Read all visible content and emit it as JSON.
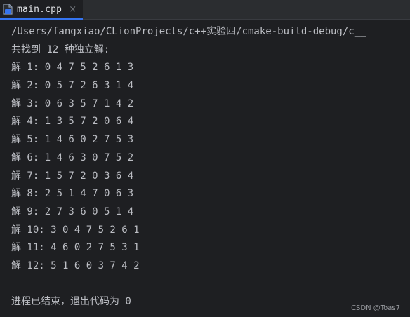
{
  "tab": {
    "filename": "main.cpp",
    "close_glyph": "×",
    "icon": "cpp-file-icon",
    "accent_color": "#3574f0"
  },
  "console": {
    "command_path": "/Users/fangxiao/CLionProjects/c++实验四/cmake-build-debug/c__",
    "summary": "共找到 12 种独立解:",
    "solutions": [
      "解 1: 0 4 7 5 2 6 1 3",
      "解 2: 0 5 7 2 6 3 1 4",
      "解 3: 0 6 3 5 7 1 4 2",
      "解 4: 1 3 5 7 2 0 6 4",
      "解 5: 1 4 6 0 2 7 5 3",
      "解 6: 1 4 6 3 0 7 5 2",
      "解 7: 1 5 7 2 0 3 6 4",
      "解 8: 2 5 1 4 7 0 6 3",
      "解 9: 2 7 3 6 0 5 1 4",
      "解 10: 3 0 4 7 5 2 6 1",
      "解 11: 4 6 0 2 7 5 3 1",
      "解 12: 5 1 6 0 3 7 4 2"
    ],
    "exit_message": "进程已结束，退出代码为 0"
  },
  "watermark": "CSDN @Toas7"
}
